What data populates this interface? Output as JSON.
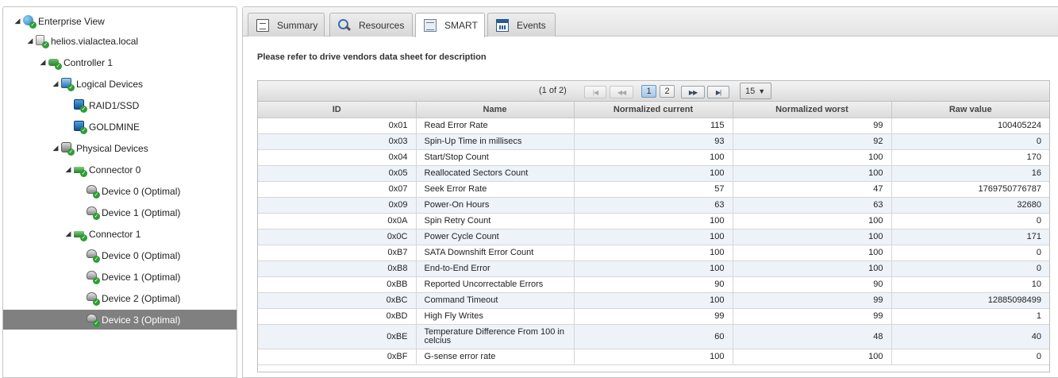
{
  "tree": {
    "items": [
      {
        "label": "Enterprise View",
        "icon": "globe-icon",
        "expanded": true
      },
      {
        "label": "helios.vialactea.local",
        "icon": "server-icon",
        "expanded": true
      },
      {
        "label": "Controller 1",
        "icon": "controller-icon",
        "expanded": true
      },
      {
        "label": "Logical Devices",
        "icon": "logical-devices-icon",
        "expanded": true
      },
      {
        "label": "RAID1/SSD",
        "icon": "logical-drive-icon"
      },
      {
        "label": "GOLDMINE",
        "icon": "logical-drive-icon"
      },
      {
        "label": "Physical Devices",
        "icon": "physical-devices-icon",
        "expanded": true
      },
      {
        "label": "Connector 0",
        "icon": "connector-icon",
        "expanded": true
      },
      {
        "label": "Device 0 (Optimal)",
        "icon": "device-icon"
      },
      {
        "label": "Device 1 (Optimal)",
        "icon": "device-icon"
      },
      {
        "label": "Connector 1",
        "icon": "connector-icon",
        "expanded": true
      },
      {
        "label": "Device 0 (Optimal)",
        "icon": "device-icon"
      },
      {
        "label": "Device 1 (Optimal)",
        "icon": "device-icon"
      },
      {
        "label": "Device 2 (Optimal)",
        "icon": "device-icon"
      },
      {
        "label": "Device 3 (Optimal)",
        "icon": "device-icon",
        "selected": true
      }
    ]
  },
  "tabs": [
    {
      "label": "Summary",
      "icon": "document-icon"
    },
    {
      "label": "Resources",
      "icon": "search-icon"
    },
    {
      "label": "SMART",
      "icon": "table-icon",
      "active": true
    },
    {
      "label": "Events",
      "icon": "calendar-icon"
    }
  ],
  "note": "Please refer to drive vendors data sheet for description",
  "paginator": {
    "status": "(1 of 2)",
    "first": "|◀",
    "prev": "◀◀",
    "pages": [
      "1",
      "2"
    ],
    "current_page": "1",
    "next": "▶▶",
    "last": "▶|",
    "rows_per_page": "15",
    "caret": "▼"
  },
  "table": {
    "columns": [
      "ID",
      "Name",
      "Normalized current",
      "Normalized worst",
      "Raw value"
    ],
    "rows": [
      {
        "id": "0x01",
        "name": "Read Error Rate",
        "current": "115",
        "worst": "99",
        "raw": "100405224"
      },
      {
        "id": "0x03",
        "name": "Spin-Up Time in millisecs",
        "current": "93",
        "worst": "92",
        "raw": "0"
      },
      {
        "id": "0x04",
        "name": "Start/Stop Count",
        "current": "100",
        "worst": "100",
        "raw": "170"
      },
      {
        "id": "0x05",
        "name": "Reallocated Sectors Count",
        "current": "100",
        "worst": "100",
        "raw": "16"
      },
      {
        "id": "0x07",
        "name": "Seek Error Rate",
        "current": "57",
        "worst": "47",
        "raw": "1769750776787"
      },
      {
        "id": "0x09",
        "name": "Power-On Hours",
        "current": "63",
        "worst": "63",
        "raw": "32680"
      },
      {
        "id": "0x0A",
        "name": "Spin Retry Count",
        "current": "100",
        "worst": "100",
        "raw": "0"
      },
      {
        "id": "0x0C",
        "name": "Power Cycle Count",
        "current": "100",
        "worst": "100",
        "raw": "171"
      },
      {
        "id": "0xB7",
        "name": "SATA Downshift Error Count",
        "current": "100",
        "worst": "100",
        "raw": "0"
      },
      {
        "id": "0xB8",
        "name": "End-to-End Error",
        "current": "100",
        "worst": "100",
        "raw": "0"
      },
      {
        "id": "0xBB",
        "name": "Reported Uncorrectable Errors",
        "current": "90",
        "worst": "90",
        "raw": "10"
      },
      {
        "id": "0xBC",
        "name": "Command Timeout",
        "current": "100",
        "worst": "99",
        "raw": "12885098499"
      },
      {
        "id": "0xBD",
        "name": "High Fly Writes",
        "current": "99",
        "worst": "99",
        "raw": "1"
      },
      {
        "id": "0xBE",
        "name": "Temperature Difference From 100 in celcius",
        "current": "60",
        "worst": "48",
        "raw": "40"
      },
      {
        "id": "0xBF",
        "name": "G-sense error rate",
        "current": "100",
        "worst": "100",
        "raw": "0"
      }
    ]
  }
}
